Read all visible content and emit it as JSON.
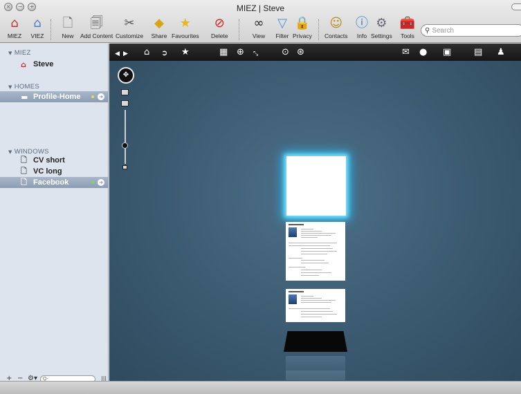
{
  "window": {
    "title": "MIEZ | Steve"
  },
  "toolbar": {
    "items": [
      {
        "label": "MIEZ",
        "icon": "home-icon"
      },
      {
        "label": "VIEZ",
        "icon": "viez-icon"
      },
      {
        "label": "New",
        "icon": "new-document-icon"
      },
      {
        "label": "Add Content",
        "icon": "add-content-icon"
      },
      {
        "label": "Customize",
        "icon": "tools-icon"
      },
      {
        "label": "Share",
        "icon": "share-icon"
      },
      {
        "label": "Favourites",
        "icon": "star-icon"
      },
      {
        "label": "Delete",
        "icon": "delete-icon"
      },
      {
        "label": "View",
        "icon": "binoculars-icon"
      },
      {
        "label": "Filter",
        "icon": "filter-icon"
      },
      {
        "label": "Privacy",
        "icon": "lock-icon"
      },
      {
        "label": "Contacts",
        "icon": "contacts-icon"
      },
      {
        "label": "Info",
        "icon": "info-icon"
      },
      {
        "label": "Settings",
        "icon": "gear-icon"
      },
      {
        "label": "Tools",
        "icon": "toolbox-icon"
      }
    ],
    "search_placeholder": "Search"
  },
  "sidebar": {
    "sections": [
      {
        "title": "MIEZ",
        "items": [
          {
            "label": "Steve",
            "icon": "home-icon",
            "selected": false
          }
        ]
      },
      {
        "title": "HOMES",
        "items": [
          {
            "label": "Profile-Home",
            "icon": "monitor-icon",
            "selected": true,
            "status_color": "#e6d95a"
          }
        ]
      },
      {
        "title": "WINDOWS",
        "items": [
          {
            "label": "CV short",
            "icon": "document-icon",
            "selected": false
          },
          {
            "label": "VC long",
            "icon": "document-icon",
            "selected": false
          },
          {
            "label": "Facebook",
            "icon": "document-icon",
            "selected": true,
            "status_color": "#7fd35a"
          }
        ]
      }
    ],
    "bottom_filter_placeholder": "Q-"
  },
  "viewer": {
    "toolbar_icons": [
      "back-arrow-icon",
      "forward-arrow-icon",
      "home-icon",
      "next-circle-icon",
      "star-icon",
      "grid-icon",
      "globe-icon",
      "fullscreen-icon",
      "download-circle-icon",
      "navigation-circle-icon",
      "mail-icon",
      "chat-bubble-icon",
      "camera-add-icon",
      "briefcase-icon",
      "person-icon"
    ],
    "colors": {
      "glow": "#28b8f0",
      "background": "#3b5a70"
    }
  }
}
